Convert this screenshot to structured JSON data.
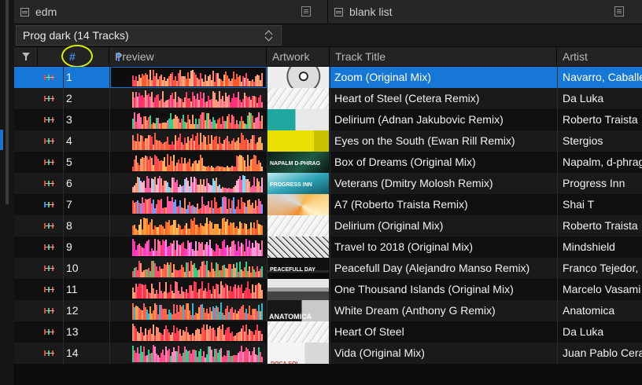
{
  "panels": {
    "left": {
      "title": "edm"
    },
    "right": {
      "title": "blank list"
    }
  },
  "playlist": {
    "selected": "Prog dark (14 Tracks)"
  },
  "columns": {
    "num": "#",
    "preview": "Preview",
    "artwork": "Artwork",
    "title": "Track Title",
    "artist": "Artist"
  },
  "tracks": [
    {
      "num": "1",
      "title": "Zoom (Original Mix)",
      "artist": "Navarro, Caballe",
      "art": "disk-white",
      "selected": true
    },
    {
      "num": "2",
      "title": "Heart of Steel (Cetera Remix)",
      "artist": "Da Luka",
      "art": "sketch-white"
    },
    {
      "num": "3",
      "title": "Delirium (Adnan Jakubovic Remix)",
      "artist": "Roberto Traista",
      "art": "teal-white"
    },
    {
      "num": "4",
      "title": "Eyes on the South (Ewan Rill Remix)",
      "artist": "Stergios",
      "art": "yellow"
    },
    {
      "num": "5",
      "title": "Box of Dreams (Original Mix)",
      "artist": "Napalm, d-phrag",
      "art": "dark-green",
      "art_label": "NAPALM D-PHRAG"
    },
    {
      "num": "6",
      "title": "Veterans (Dmitry Molosh Remix)",
      "artist": "Progress Inn",
      "art": "teal-sky",
      "art_label": "PROGRESS INN"
    },
    {
      "num": "7",
      "title": "A7 (Roberto Traista Remix)",
      "artist": "Shai T",
      "art": "orange-geo"
    },
    {
      "num": "8",
      "title": "Delirium (Original Mix)",
      "artist": "Roberto Traista",
      "art": "sketch-white"
    },
    {
      "num": "9",
      "title": "Travel to 2018 (Original Mix)",
      "artist": "Mindshield",
      "art": "bw-art"
    },
    {
      "num": "10",
      "title": "Peacefull Day (Alejandro Manso Remix)",
      "artist": "Franco Tejedor,",
      "art": "dark",
      "art_label": "PEACEFULL DAY"
    },
    {
      "num": "11",
      "title": "One Thousand Islands (Original Mix)",
      "artist": "Marcelo Vasami",
      "art": "islands"
    },
    {
      "num": "12",
      "title": "White Dream (Anthony G Remix)",
      "artist": "Anatomica",
      "art": "anatomica",
      "art_label": "ANATOMICA"
    },
    {
      "num": "13",
      "title": "Heart Of Steel",
      "artist": "Da Luka",
      "art": "sketch-white"
    },
    {
      "num": "14",
      "title": "Vida (Original Mix)",
      "artist": "Juan Pablo Cera",
      "art": "vida",
      "art_label": "DOCA SOL"
    }
  ],
  "colors": {
    "selection": "#1677d6",
    "accent": "#3b8ef0",
    "highlight_ring": "#d8f000"
  }
}
